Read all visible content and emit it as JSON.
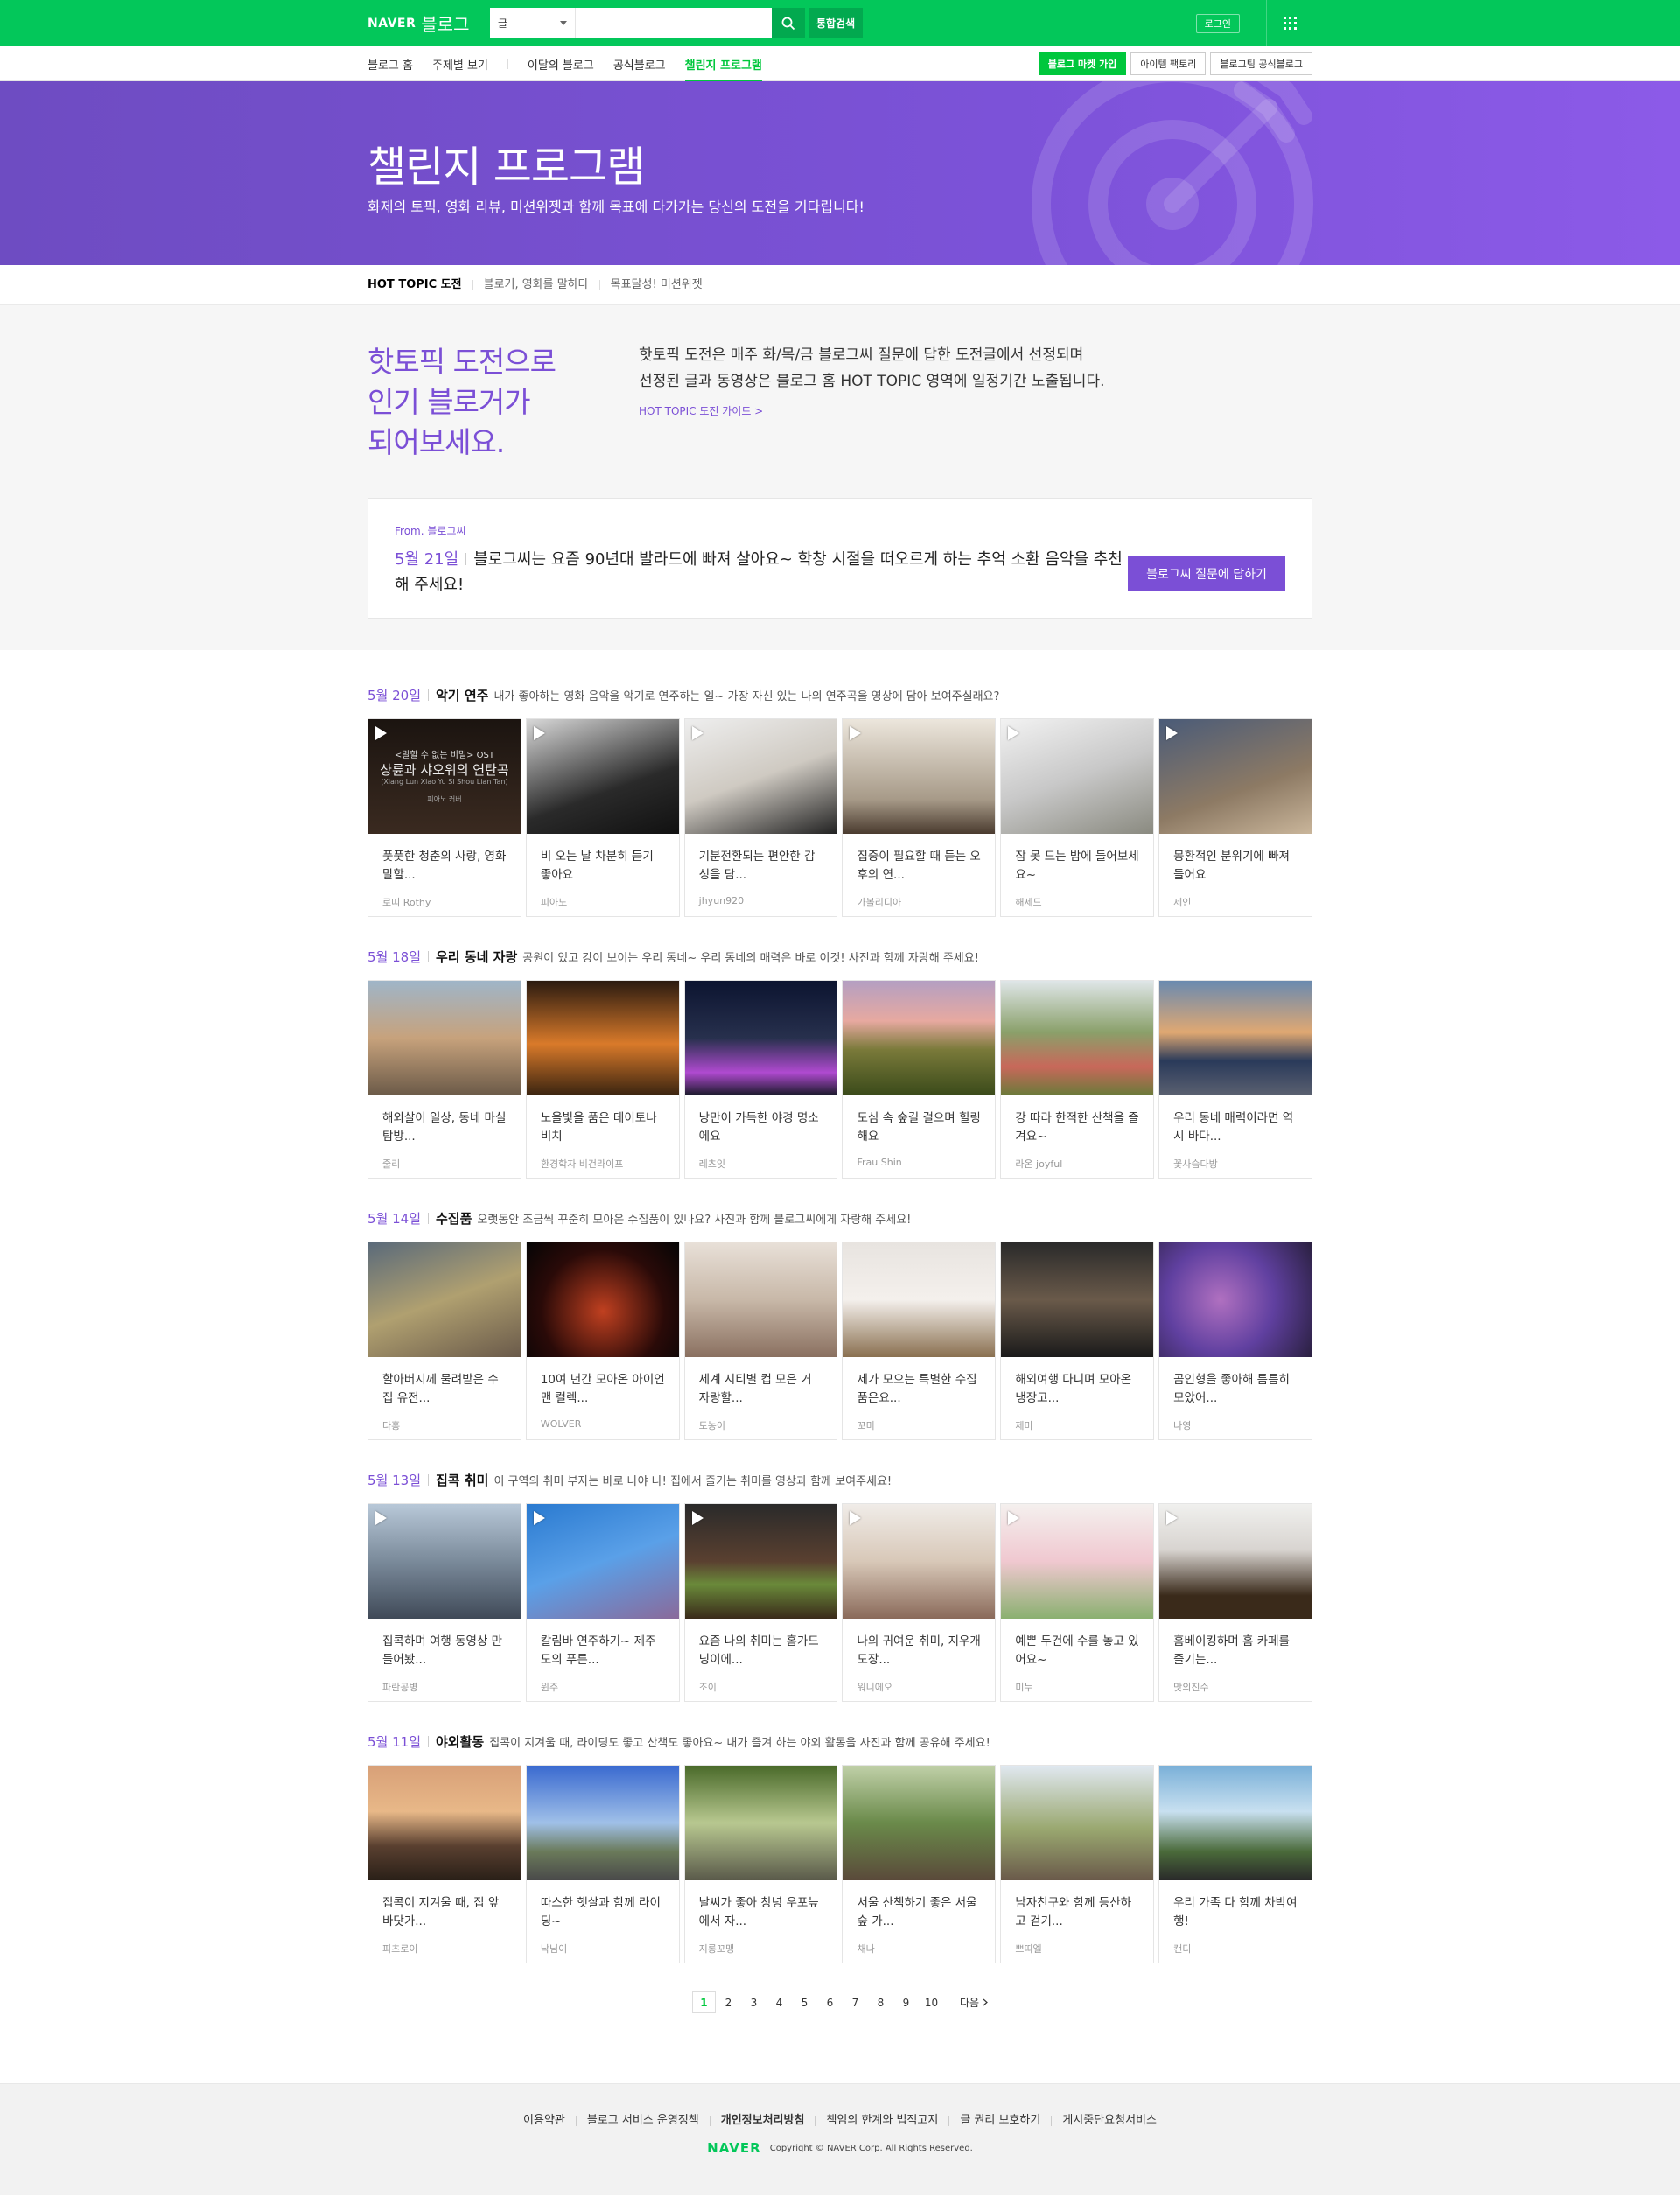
{
  "header": {
    "logo_naver": "NAVER",
    "logo_blog": "블로그",
    "search_select": "글",
    "search_input": "",
    "total_search": "통합검색",
    "login": "로그인"
  },
  "lnb": {
    "items": [
      "블로그 홈",
      "주제별 보기",
      "이달의 블로그",
      "공식블로그",
      "챌린지 프로그램"
    ],
    "active_index": 4,
    "right_buttons": [
      "블로그 마켓 가입",
      "아이템 팩토리",
      "블로그팀 공식블로그"
    ]
  },
  "hero": {
    "title": "챌린지 프로그램",
    "desc": "화제의 토픽, 영화 리뷰, 미션위젯과 함께 목표에 다가가는 당신의 도전을 기다립니다!"
  },
  "subnav": [
    "HOT TOPIC 도전",
    "블로거, 영화를 말하다",
    "목표달성! 미션위젯"
  ],
  "intro": {
    "headline_1": "핫토픽 도전으로",
    "headline_2": "인기 블로거가",
    "headline_3": "되어보세요.",
    "text_1": "핫토픽 도전은 매주 화/목/금 블로그씨 질문에 답한 도전글에서 선정되며",
    "text_2": "선정된 글과 동영상은 블로그 홈 HOT TOPIC 영역에 일정기간 노출됩니다.",
    "guide_link": "HOT TOPIC 도전 가이드 >",
    "question": {
      "from": "From. 블로그씨",
      "date": "5월 21일",
      "text": "블로그씨는 요즘 90년대 발라드에 빠져 살아요~ 학창 시절을 떠오르게 하는 추억 소환 음악을 추천해 주세요!",
      "button": "블로그씨 질문에 답하기"
    }
  },
  "sections": [
    {
      "date": "5월 20일",
      "title": "악기 연주",
      "desc": "내가 좋아하는 영화 음악을 악기로 연주하는 일~ 가장 자신 있는 나의 연주곡을 영상에 담아 보여주실래요?",
      "cards": [
        {
          "title": "풋풋한 청춘의 사랑, 영화 말할...",
          "author": "로띠 Rothy",
          "video": true,
          "thumb_text_1": "<말할 수 없는 비밀> OST",
          "thumb_text_2": "샹륜과 샤오위의 연탄곡",
          "thumb_text_3": "(Xiang Lun Xiao Yu Si Shou Lian Tan)",
          "thumb_text_4": "피아노 커버"
        },
        {
          "title": "비 오는 날 차분히 듣기 좋아요",
          "author": "피아노",
          "video": true
        },
        {
          "title": "기분전환되는 편안한 감성을 담...",
          "author": "jhyun920",
          "video": true
        },
        {
          "title": "집중이 필요할 때 듣는 오후의 연...",
          "author": "가볼리디아",
          "video": true
        },
        {
          "title": "잠 못 드는 밤에 들어보세요~",
          "author": "해세드",
          "video": true
        },
        {
          "title": "몽환적인 분위기에 빠져들어요",
          "author": "제인",
          "video": true
        }
      ]
    },
    {
      "date": "5월 18일",
      "title": "우리 동네 자랑",
      "desc": "공원이 있고 강이 보이는 우리 동네~ 우리 동네의 매력은 바로 이것! 사진과 함께 자랑해 주세요!",
      "cards": [
        {
          "title": "해외살이 일상, 동네 마실 탐방...",
          "author": "줄리",
          "video": false
        },
        {
          "title": "노을빛을 품은 데이토나 비치",
          "author": "환경학자 비건라이프",
          "video": false
        },
        {
          "title": "낭만이 가득한 야경 명소에요",
          "author": "레츠잇",
          "video": false
        },
        {
          "title": "도심 속 숲길 걸으며 힐링해요",
          "author": "Frau Shin",
          "video": false
        },
        {
          "title": "강 따라 한적한 산책을 즐겨요~",
          "author": "라온 joyful",
          "video": false
        },
        {
          "title": "우리 동네 매력이라면 역시 바다...",
          "author": "꽃사슴다방",
          "video": false
        }
      ]
    },
    {
      "date": "5월 14일",
      "title": "수집품",
      "desc": "오랫동안 조금씩 꾸준히 모아온 수집품이 있나요? 사진과 함께 블로그씨에게 자랑해 주세요!",
      "cards": [
        {
          "title": "할아버지께 물려받은 수집 유전...",
          "author": "다홍",
          "video": false
        },
        {
          "title": "10여 년간 모아온 아이언맨 컬렉...",
          "author": "WOLVER",
          "video": false
        },
        {
          "title": "세계 시티별 컵 모은 거 자랑할...",
          "author": "토농이",
          "video": false
        },
        {
          "title": "제가 모으는 특별한 수집품은요...",
          "author": "꼬미",
          "video": false
        },
        {
          "title": "해외여행 다니며 모아온 냉장고...",
          "author": "제미",
          "video": false
        },
        {
          "title": "곰인형을 좋아해 틈틈히 모았어...",
          "author": "나영",
          "video": false
        }
      ]
    },
    {
      "date": "5월 13일",
      "title": "집콕 취미",
      "desc": "이 구역의 취미 부자는 바로 나야 나! 집에서 즐기는 취미를 영상과 함께 보여주세요!",
      "cards": [
        {
          "title": "집콕하며 여행 동영상 만들어봤...",
          "author": "파란공병",
          "video": true
        },
        {
          "title": "칼림바 연주하기~ 제주도의 푸른...",
          "author": "윈주",
          "video": true
        },
        {
          "title": "요즘 나의 취미는 홈가드닝이에...",
          "author": "조이",
          "video": true
        },
        {
          "title": "나의 귀여운 취미, 지우개 도장...",
          "author": "워니에오",
          "video": true
        },
        {
          "title": "예쁜 두건에 수를 놓고 있어요~",
          "author": "미누",
          "video": true
        },
        {
          "title": "홈베이킹하며 홈 카페를 즐기는...",
          "author": "맛의진수",
          "video": true
        }
      ]
    },
    {
      "date": "5월 11일",
      "title": "야외활동",
      "desc": "집콕이 지겨울 때, 라이딩도 좋고 산책도 좋아요~ 내가 즐겨 하는 야외 활동을 사진과 함께 공유해 주세요!",
      "cards": [
        {
          "title": "집콕이 지겨울 때, 집 앞 바닷가...",
          "author": "피츠로이",
          "video": false
        },
        {
          "title": "따스한 햇살과 함께 라이딩~",
          "author": "낙님이",
          "video": false
        },
        {
          "title": "날씨가 좋아 창녕 우포늪에서 자...",
          "author": "지롱꼬맹",
          "video": false
        },
        {
          "title": "서울 산책하기 좋은 서울 숲 가...",
          "author": "채나",
          "video": false
        },
        {
          "title": "남자친구와 함께 등산하고 걷기...",
          "author": "쁘띠엘",
          "video": false
        },
        {
          "title": "우리 가족 다 함께 차박여행!",
          "author": "캔디",
          "video": false
        }
      ]
    }
  ],
  "pagination": {
    "pages": [
      "1",
      "2",
      "3",
      "4",
      "5",
      "6",
      "7",
      "8",
      "9",
      "10"
    ],
    "current": "1",
    "next": "다음"
  },
  "footer": {
    "links": [
      "이용약관",
      "블로그 서비스 운영정책",
      "개인정보처리방침",
      "책임의 한계와 법적고지",
      "글 권리 보호하기",
      "게시중단요청서비스"
    ],
    "bold_index": 2,
    "logo": "NAVER",
    "copyright": "Copyright © NAVER Corp. All Rights Reserved."
  },
  "colors": {
    "naver_green": "#03c75a",
    "accent_purple": "#7b4fd6"
  }
}
